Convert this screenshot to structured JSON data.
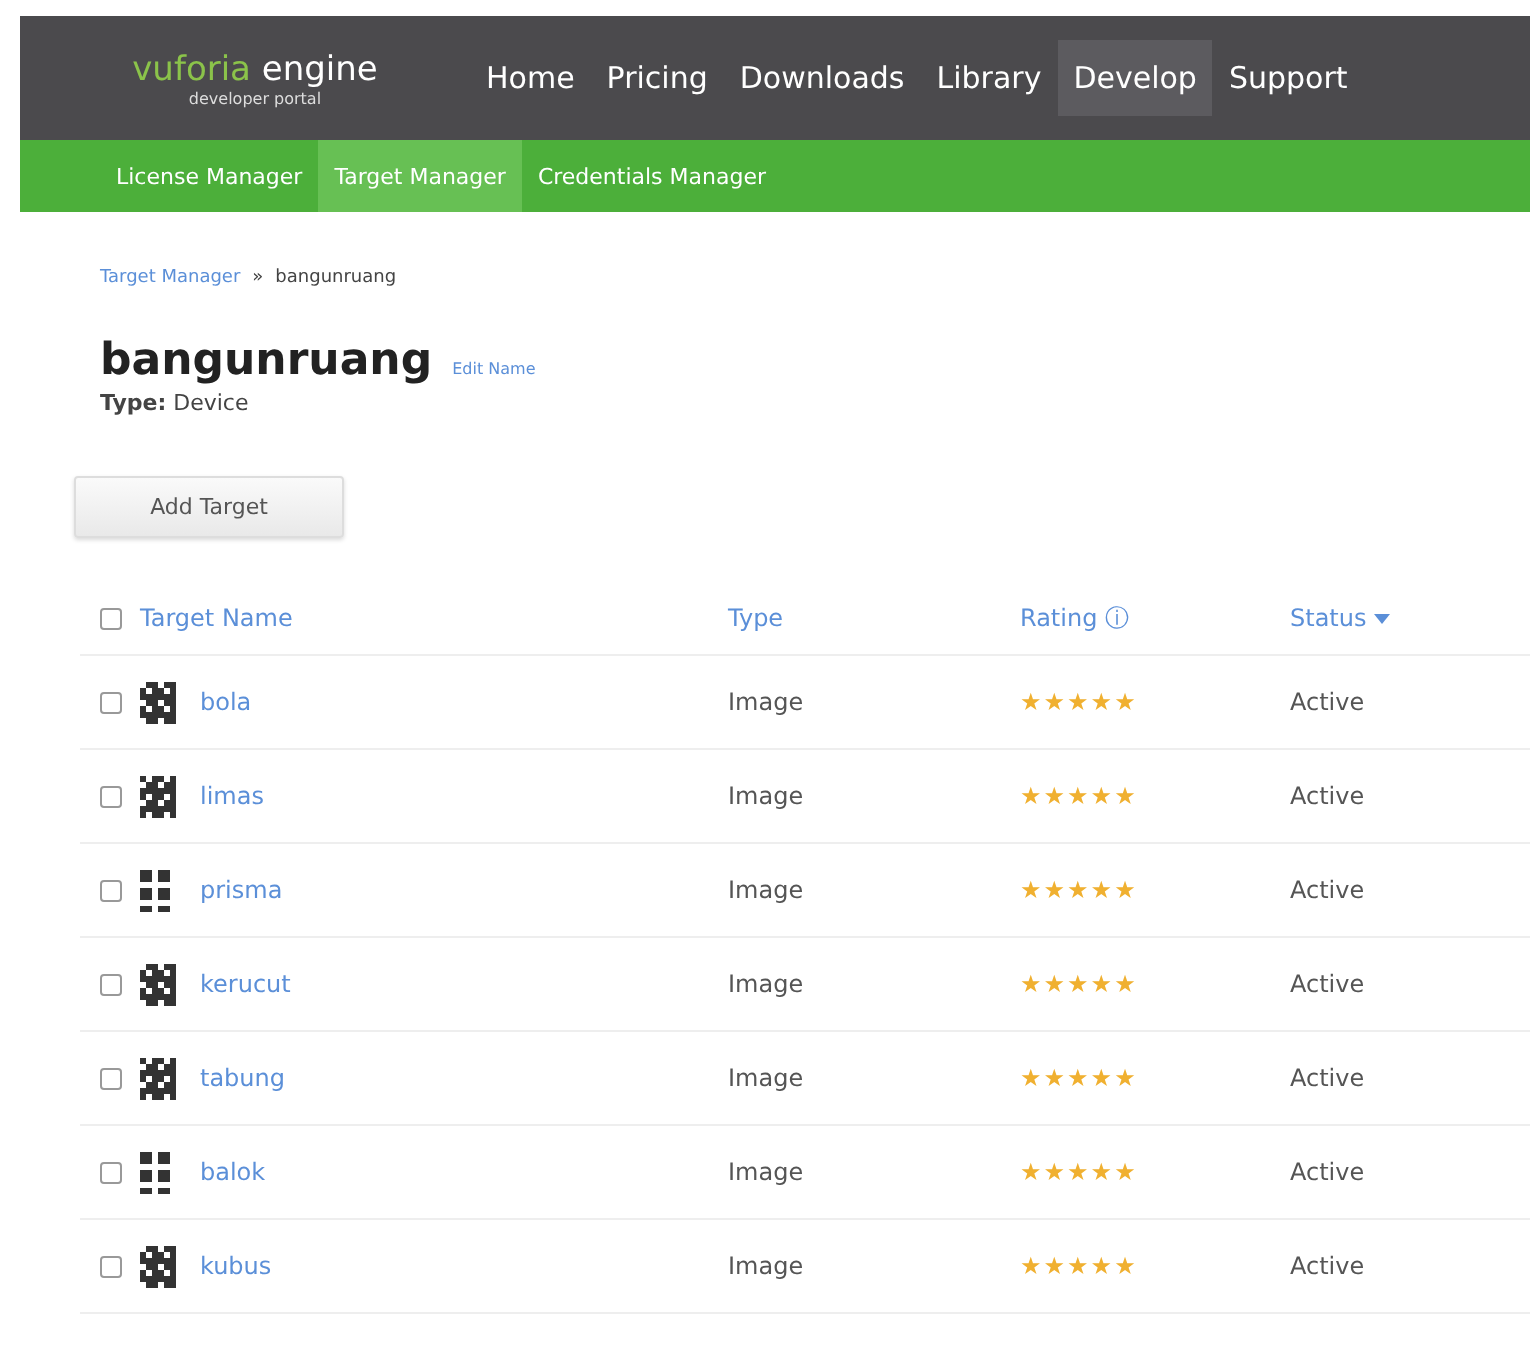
{
  "header": {
    "logo": {
      "brand": "vuforia",
      "product": "engine",
      "tagline": "developer portal"
    },
    "nav": [
      {
        "label": "Home",
        "selected": false
      },
      {
        "label": "Pricing",
        "selected": false
      },
      {
        "label": "Downloads",
        "selected": false
      },
      {
        "label": "Library",
        "selected": false
      },
      {
        "label": "Develop",
        "selected": true
      },
      {
        "label": "Support",
        "selected": false
      }
    ],
    "subnav": [
      {
        "label": "License Manager",
        "selected": false
      },
      {
        "label": "Target Manager",
        "selected": true
      },
      {
        "label": "Credentials Manager",
        "selected": false
      }
    ]
  },
  "breadcrumb": {
    "link": "Target Manager",
    "separator": "»",
    "current": "bangunruang"
  },
  "database": {
    "name": "bangunruang",
    "edit_link": "Edit Name",
    "type_label": "Type:",
    "type_value": "Device"
  },
  "add_button": "Add Target",
  "table": {
    "select_all_checked": false,
    "columns": [
      {
        "label": "Target Name"
      },
      {
        "label": "Type"
      },
      {
        "label": "Rating",
        "info": "ⓘ"
      },
      {
        "label": "Status",
        "sortable": true
      }
    ],
    "rows": [
      {
        "checked": false,
        "name": "bola",
        "type": "Image",
        "stars": 5,
        "status": "Active"
      },
      {
        "checked": false,
        "name": "limas",
        "type": "Image",
        "stars": 5,
        "status": "Active"
      },
      {
        "checked": false,
        "name": "prisma",
        "type": "Image",
        "stars": 5,
        "status": "Active"
      },
      {
        "checked": false,
        "name": "kerucut",
        "type": "Image",
        "stars": 5,
        "status": "Active"
      },
      {
        "checked": false,
        "name": "tabung",
        "type": "Image",
        "stars": 5,
        "status": "Active"
      },
      {
        "checked": false,
        "name": "balok",
        "type": "Image",
        "stars": 5,
        "status": "Active"
      },
      {
        "checked": false,
        "name": "kubus",
        "type": "Image",
        "stars": 5,
        "status": "Active"
      }
    ]
  }
}
